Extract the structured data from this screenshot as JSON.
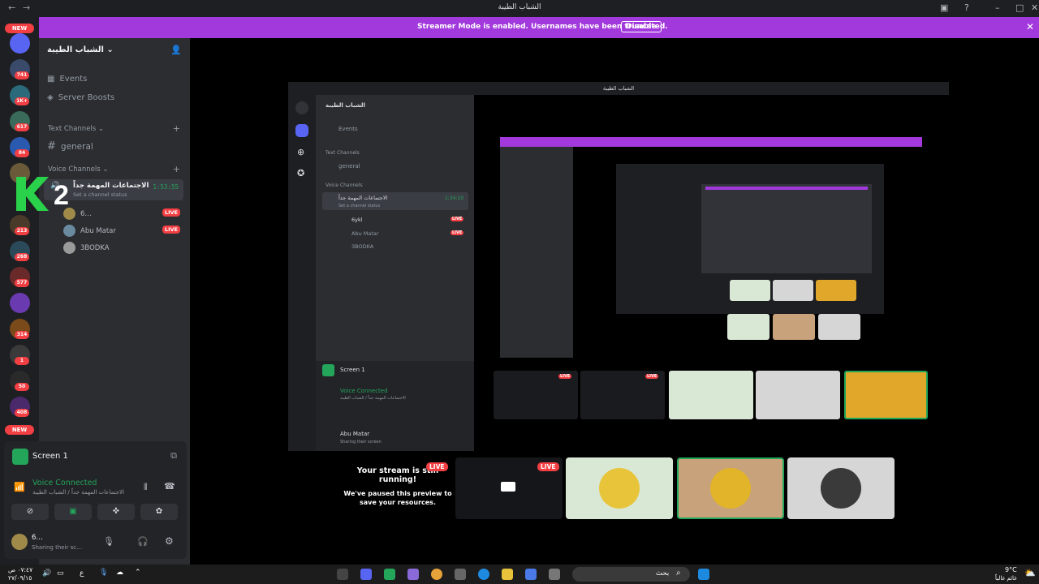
{
  "window": {
    "title": "الشباب الطيبة"
  },
  "banner": {
    "message": "Streamer Mode is enabled. Usernames have been truncated.",
    "disable_label": "Disable"
  },
  "guild_badges": [
    "NEW",
    "741",
    "1K+",
    "617",
    "84",
    "213",
    "268",
    "577",
    "314",
    "1",
    "50",
    "408",
    "NEW"
  ],
  "server": {
    "name": "الشباب الطيبة"
  },
  "sidebar": {
    "events": "Events",
    "server_boosts": "Server Boosts",
    "text_channels": "Text Channels",
    "general": "general",
    "voice_channels": "Voice Channels",
    "voice_channel": {
      "name": "الاجتماعات المهمة جداً",
      "status": "Set a channel status",
      "timer": "1:53:55"
    },
    "members": [
      {
        "name": "6…",
        "live": "LIVE"
      },
      {
        "name": "Abu Matar",
        "live": "LIVE"
      },
      {
        "name": "3BODKA",
        "live": ""
      }
    ]
  },
  "panel": {
    "stream_title": "Screen 1",
    "voice_connected": "Voice Connected",
    "voice_sub": "الاجتماعات المهمة جداً / الشباب الطيبة",
    "user_name": "6…",
    "user_status": "Sharing their sc…"
  },
  "inner_window": {
    "title": "الشباب الطيبة",
    "server_name": "الشباب الطيبة",
    "events": "Events",
    "text_channels": "Text Channels",
    "general": "general",
    "voice_channels": "Voice Channels",
    "vc_name": "الاجتماعات المهمة جداً",
    "vc_timer": "1:34:10",
    "vc_status": "Set a channel status",
    "members": [
      "6ykl",
      "Abu Matar",
      "3BODKA"
    ],
    "live": "LIVE",
    "screen": "Screen 1",
    "voice_connected": "Voice Connected",
    "voice_sub": "الاجتماعات المهمة جداً / الشباب الطيبة",
    "user_name": "Abu Matar",
    "user_status": "Sharing their screen"
  },
  "stage": {
    "paused_title": "Your stream is still running!",
    "paused_sub": "We've paused this preview to save your resources.",
    "live": "LIVE"
  },
  "taskbar": {
    "time": "٠٧:٤٧ ص",
    "date": "٢٧/٠٩/١٥",
    "lang": "ع",
    "search_placeholder": "بحث",
    "weather_temp": "9°C",
    "weather_desc": "غائم غالباً"
  },
  "colors": {
    "banner": "#a239dc",
    "live": "#f23f43",
    "connected": "#23a55a"
  }
}
